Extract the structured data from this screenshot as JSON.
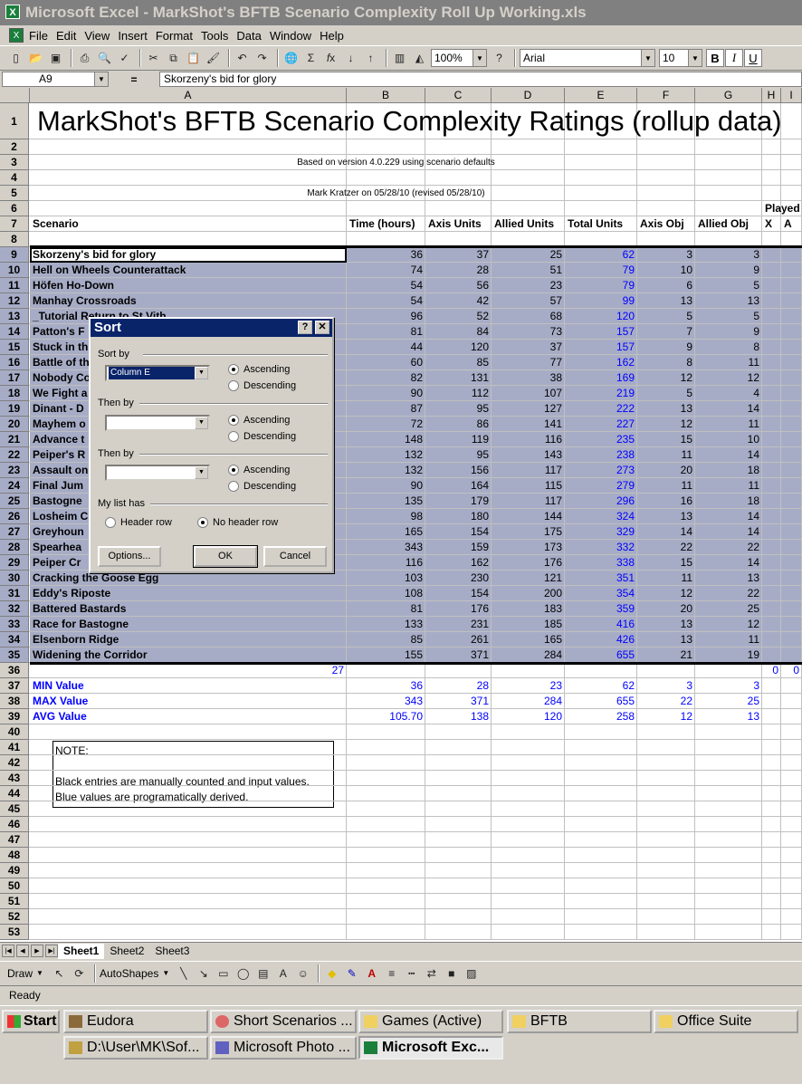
{
  "window": {
    "title": "Microsoft Excel - MarkShot's BFTB Scenario Complexity Roll Up Working.xls"
  },
  "menu": [
    "File",
    "Edit",
    "View",
    "Insert",
    "Format",
    "Tools",
    "Data",
    "Window",
    "Help"
  ],
  "toolbar": {
    "zoom": "100%",
    "font": "Arial",
    "size": "10",
    "bold": "B",
    "italic": "I",
    "underline": "U"
  },
  "formula": {
    "namebox": "A9",
    "eq": "=",
    "content": "Skorzeny's bid for glory"
  },
  "columns": [
    "A",
    "B",
    "C",
    "D",
    "E",
    "F",
    "G",
    "H",
    "I"
  ],
  "sheet": {
    "title": "MarkShot's BFTB Scenario Complexity Ratings (rollup data)",
    "subtitle1": "Based on version 4.0.229 using scenario defaults",
    "subtitle2": "Mark Kratzer on 05/28/10 (revised 05/28/10)",
    "played": "Played",
    "headers": [
      "Scenario",
      "Time (hours)",
      "Axis Units",
      "Allied Units",
      "Total Units",
      "Axis Obj",
      "Allied Obj",
      "X",
      "A"
    ],
    "rows": [
      [
        "Skorzeny's bid for glory",
        "36",
        "37",
        "25",
        "62",
        "3",
        "3"
      ],
      [
        "Hell on Wheels Counterattack",
        "74",
        "28",
        "51",
        "79",
        "10",
        "9"
      ],
      [
        "Höfen Ho-Down",
        "54",
        "56",
        "23",
        "79",
        "6",
        "5"
      ],
      [
        "Manhay Crossroads",
        "54",
        "42",
        "57",
        "99",
        "13",
        "13"
      ],
      [
        "_Tutorial Return to St Vith",
        "96",
        "52",
        "68",
        "120",
        "5",
        "5"
      ],
      [
        "Patton's F",
        "81",
        "84",
        "73",
        "157",
        "7",
        "9"
      ],
      [
        "Stuck in th",
        "44",
        "120",
        "37",
        "157",
        "9",
        "8"
      ],
      [
        "Battle of th",
        "60",
        "85",
        "77",
        "162",
        "8",
        "11"
      ],
      [
        "Nobody Co",
        "82",
        "131",
        "38",
        "169",
        "12",
        "12"
      ],
      [
        "We Fight a",
        "90",
        "112",
        "107",
        "219",
        "5",
        "4"
      ],
      [
        "Dinant - D",
        "87",
        "95",
        "127",
        "222",
        "13",
        "14"
      ],
      [
        "Mayhem o",
        "72",
        "86",
        "141",
        "227",
        "12",
        "11"
      ],
      [
        "Advance t",
        "148",
        "119",
        "116",
        "235",
        "15",
        "10"
      ],
      [
        "Peiper's R",
        "132",
        "95",
        "143",
        "238",
        "11",
        "14"
      ],
      [
        "Assault on",
        "132",
        "156",
        "117",
        "273",
        "20",
        "18"
      ],
      [
        "Final Jum",
        "90",
        "164",
        "115",
        "279",
        "11",
        "11"
      ],
      [
        "Bastogne",
        "135",
        "179",
        "117",
        "296",
        "16",
        "18"
      ],
      [
        "Losheim C",
        "98",
        "180",
        "144",
        "324",
        "13",
        "14"
      ],
      [
        "Greyhoun",
        "165",
        "154",
        "175",
        "329",
        "14",
        "14"
      ],
      [
        "Spearhea",
        "343",
        "159",
        "173",
        "332",
        "22",
        "22"
      ],
      [
        "Peiper Cr",
        "116",
        "162",
        "176",
        "338",
        "15",
        "14"
      ],
      [
        "Cracking the Goose Egg",
        "103",
        "230",
        "121",
        "351",
        "11",
        "13"
      ],
      [
        "Eddy's Riposte",
        "108",
        "154",
        "200",
        "354",
        "12",
        "22"
      ],
      [
        "Battered Bastards",
        "81",
        "176",
        "183",
        "359",
        "20",
        "25"
      ],
      [
        "Race for Bastogne",
        "133",
        "231",
        "185",
        "416",
        "13",
        "12"
      ],
      [
        "Elsenborn Ridge",
        "85",
        "261",
        "165",
        "426",
        "13",
        "11"
      ],
      [
        "Widening the Corridor",
        "155",
        "371",
        "284",
        "655",
        "21",
        "19"
      ]
    ],
    "count_row": {
      "a": "27",
      "h": "0",
      "i": "0"
    },
    "stats": [
      [
        "MIN Value",
        "36",
        "28",
        "23",
        "62",
        "3",
        "3"
      ],
      [
        "MAX Value",
        "343",
        "371",
        "284",
        "655",
        "22",
        "25"
      ],
      [
        "AVG Value",
        "105.70",
        "138",
        "120",
        "258",
        "12",
        "13"
      ]
    ],
    "note": [
      "NOTE:",
      "",
      "Black entries are manually counted and input values.",
      "Blue values are programatically derived."
    ]
  },
  "dialog": {
    "title": "Sort",
    "sort_by": "Sort by",
    "sort_by_value": "Column E",
    "then_by": "Then by",
    "then_by2": "Then by",
    "ascending": "Ascending",
    "descending": "Descending",
    "my_list_has": "My list has",
    "header_row": "Header row",
    "no_header_row": "No header row",
    "options": "Options...",
    "ok": "OK",
    "cancel": "Cancel"
  },
  "tabs": [
    "Sheet1",
    "Sheet2",
    "Sheet3"
  ],
  "drawbar": {
    "draw": "Draw",
    "autoshapes": "AutoShapes"
  },
  "status": "Ready",
  "taskbar": {
    "start": "Start",
    "row1": [
      "Eudora",
      "Short Scenarios ...",
      "Games (Active)",
      "BFTB",
      "Office Suite"
    ],
    "row2": [
      "D:\\User\\MK\\Sof...",
      "Microsoft Photo ...",
      "Microsoft Exc..."
    ]
  },
  "colors": {
    "blue_value": "#0000ff",
    "selection": "#a7acc6",
    "title_bar": "#0a246a"
  }
}
